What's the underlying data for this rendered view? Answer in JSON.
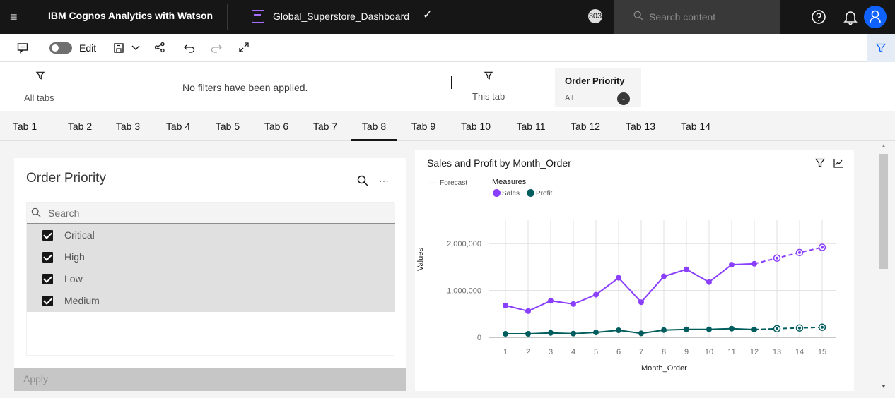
{
  "topbar": {
    "brand_bold": "IBM Cognos Analytics with Watson",
    "dashboard_name": "Global_Superstore_Dashboard",
    "notification_count": "303",
    "search_placeholder": "Search content"
  },
  "toolbar": {
    "edit_label": "Edit"
  },
  "filters": {
    "all_tabs_label": "All tabs",
    "no_filters_text": "No filters have been applied.",
    "this_tab_label": "This tab",
    "chip_title": "Order Priority",
    "chip_value": "All"
  },
  "tabs": [
    {
      "label": "Tab 1"
    },
    {
      "label": "Tab 2"
    },
    {
      "label": "Tab 3"
    },
    {
      "label": "Tab 4"
    },
    {
      "label": "Tab 5"
    },
    {
      "label": "Tab 6"
    },
    {
      "label": "Tab 7"
    },
    {
      "label": "Tab 8"
    },
    {
      "label": "Tab 9"
    },
    {
      "label": "Tab 10"
    },
    {
      "label": "Tab 11"
    },
    {
      "label": "Tab 12"
    },
    {
      "label": "Tab 13"
    },
    {
      "label": "Tab 14"
    }
  ],
  "active_tab": "Tab 8",
  "order_filter": {
    "title": "Order Priority",
    "search_placeholder": "Search",
    "items": [
      {
        "label": "Critical",
        "checked": true
      },
      {
        "label": "High",
        "checked": true
      },
      {
        "label": "Low",
        "checked": true
      },
      {
        "label": "Medium",
        "checked": true
      }
    ],
    "apply_label": "Apply"
  },
  "chart_panel": {
    "title": "Sales and Profit by Month_Order",
    "legend_forecast": "Forecast",
    "legend_title": "Measures",
    "legend_sales": "Sales",
    "legend_profit": "Profit"
  },
  "chart_data": {
    "type": "line",
    "title": "Sales and Profit by Month_Order",
    "xlabel": "Month_Order",
    "ylabel": "Values",
    "x": [
      1,
      2,
      3,
      4,
      5,
      6,
      7,
      8,
      9,
      10,
      11,
      12,
      13,
      14,
      15
    ],
    "forecast_from": 12,
    "ylim": [
      0,
      2500000
    ],
    "yticks": [
      0,
      1000000,
      2000000
    ],
    "ytick_labels": [
      "0",
      "1,000,000",
      "2,000,000"
    ],
    "grid": true,
    "legend": "top-left",
    "series": [
      {
        "name": "Sales",
        "color": "#8a3ffc",
        "values": [
          680000,
          560000,
          780000,
          710000,
          910000,
          1270000,
          750000,
          1300000,
          1450000,
          1180000,
          1550000,
          1570000,
          1690000,
          1810000,
          1920000
        ]
      },
      {
        "name": "Profit",
        "color": "#005d5d",
        "values": [
          75000,
          75000,
          95000,
          80000,
          105000,
          150000,
          85000,
          155000,
          170000,
          170000,
          185000,
          165000,
          185000,
          200000,
          215000
        ]
      }
    ]
  }
}
